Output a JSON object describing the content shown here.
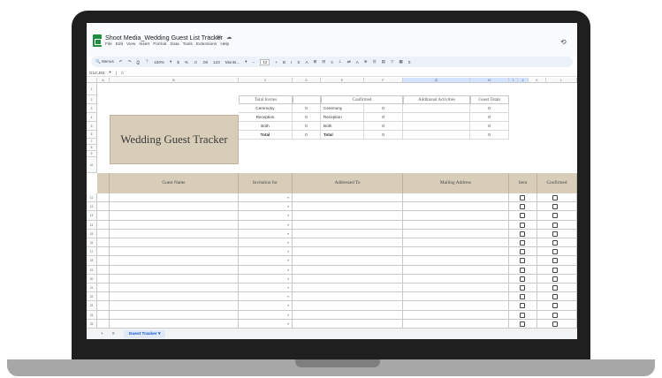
{
  "doc": {
    "title": "Shoot Media_Wedding Guest List Tracker",
    "title_icons": "☆ ⊡ ☁",
    "menus": [
      "File",
      "Edit",
      "View",
      "Insert",
      "Format",
      "Data",
      "Tools",
      "Extensions",
      "Help"
    ]
  },
  "toolbar": {
    "menus_label": "Menus",
    "items": [
      "↶",
      "↷",
      "⎙",
      "⊤",
      "100%",
      "▾",
      "$",
      "%",
      ".0",
      ".00",
      "123",
      "Monts...",
      "▾",
      "−",
      "12",
      "+",
      "B",
      "I",
      "S",
      "A",
      "⊞",
      "⊟",
      "≡",
      "⊥",
      "⇄",
      "A",
      "⊕",
      "⊡",
      "▤",
      "▽",
      "▦",
      "Σ"
    ]
  },
  "formula_bar": {
    "cell_ref": "G12:J63",
    "fx": "fx"
  },
  "columns": [
    "A",
    "B",
    "C",
    "D",
    "E",
    "F",
    "G",
    "H",
    "I",
    "J",
    "K",
    "L"
  ],
  "tracker": {
    "title": "Wedding Guest Tracker",
    "total_invites_header": "Total Invites",
    "confirmed_header": "Confirmed",
    "additional_header": "Additional Activities",
    "guest_totals_header": "Guest Totals",
    "invite_rows": [
      {
        "label": "Ceremony",
        "value": "0",
        "conf_label": "Ceremony",
        "conf_value": "0",
        "total": "0"
      },
      {
        "label": "Reception",
        "value": "0",
        "conf_label": "Reception",
        "conf_value": "0",
        "total": "0"
      },
      {
        "label": "Both",
        "value": "0",
        "conf_label": "Both",
        "conf_value": "0",
        "total": "0"
      },
      {
        "label": "Total",
        "value": "0",
        "conf_label": "Total",
        "conf_value": "0",
        "total": "0"
      }
    ]
  },
  "table": {
    "headers": {
      "guest_name": "Guest Name",
      "invitation_for": "Invitation for",
      "addressed_to": "Addressed To",
      "mailing_address": "Mailing Address",
      "sent": "Sent",
      "confirmed": "Confirmed"
    },
    "row_numbers": [
      "11",
      "12",
      "13",
      "14",
      "15",
      "16",
      "17",
      "18",
      "19",
      "20",
      "21",
      "22",
      "23",
      "24",
      "25",
      "26",
      "27"
    ]
  },
  "top_rows": [
    "1",
    "2",
    "3",
    "4",
    "5",
    "6",
    "7",
    "8",
    "9",
    "10"
  ],
  "sheet": {
    "add_label": "+",
    "list_label": "≡",
    "tab_name": "Guest Tracker",
    "tab_arrow": "▾"
  },
  "colors": {
    "tan": "#d8cdb8",
    "selected_column": "#d3e3fd",
    "sheets_green": "#1e8e3e"
  }
}
